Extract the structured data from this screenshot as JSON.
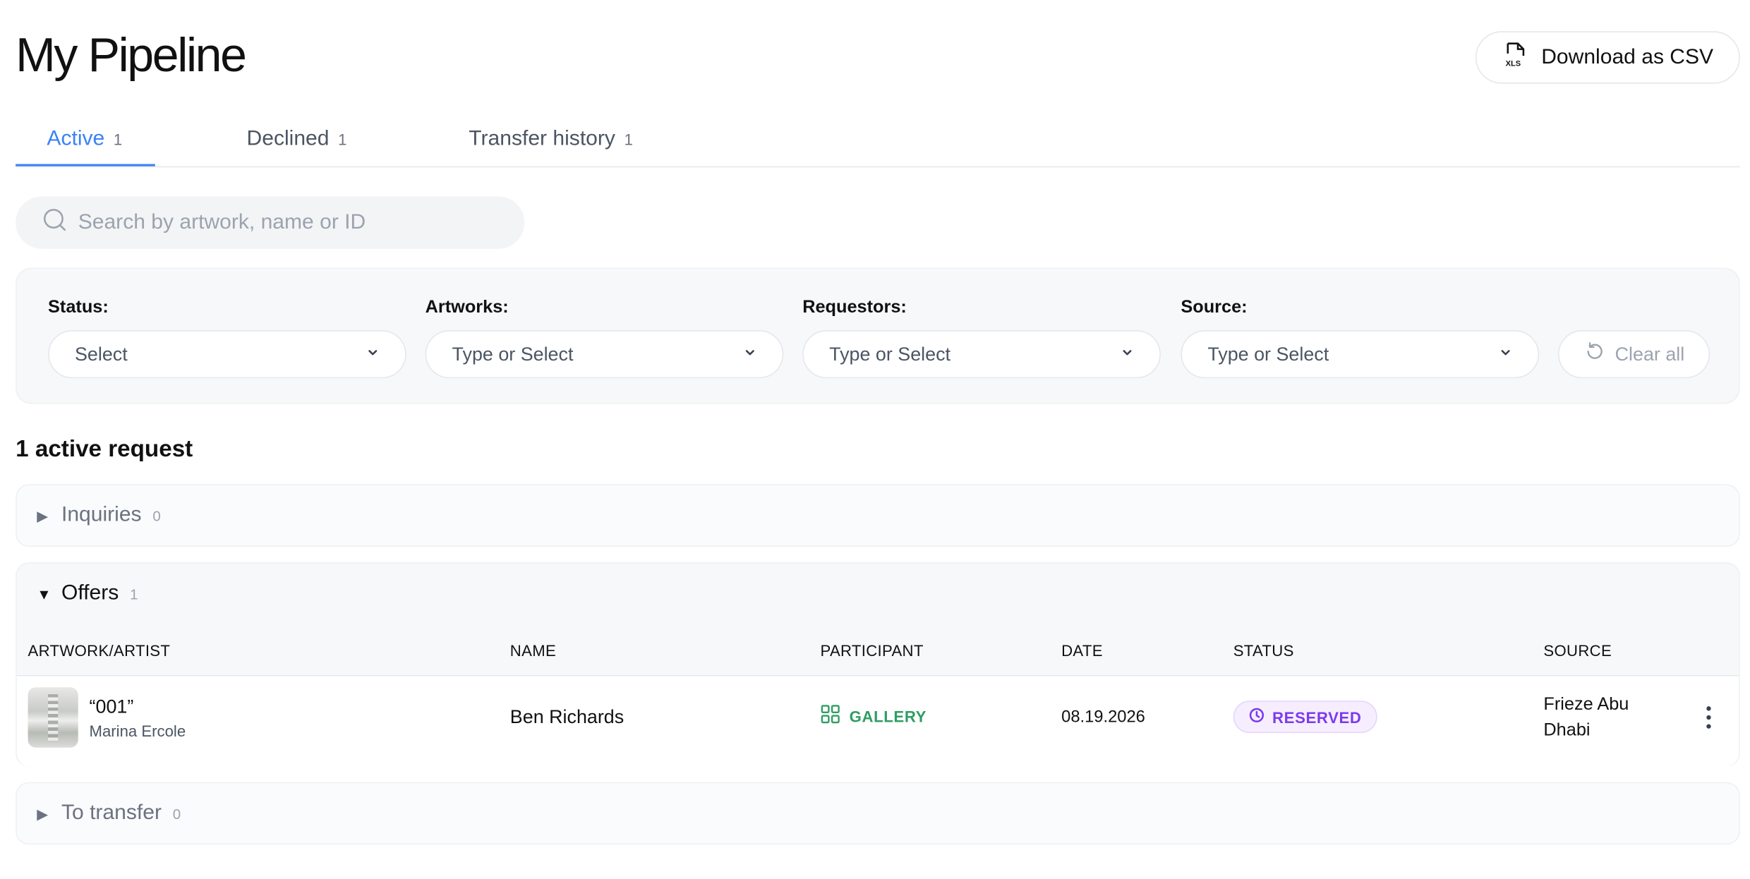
{
  "page": {
    "title": "My Pipeline"
  },
  "header": {
    "download_label": "Download as CSV",
    "download_icon": "xls-file-icon"
  },
  "tabs": [
    {
      "label": "Active",
      "count": "1",
      "active": true
    },
    {
      "label": "Declined",
      "count": "1",
      "active": false
    },
    {
      "label": "Transfer history",
      "count": "1",
      "active": false
    }
  ],
  "search": {
    "placeholder": "Search by artwork, name or ID",
    "value": ""
  },
  "filters": {
    "status": {
      "label": "Status:",
      "value": "Select"
    },
    "artworks": {
      "label": "Artworks:",
      "value": "Type or Select"
    },
    "requestors": {
      "label": "Requestors:",
      "value": "Type or Select"
    },
    "source": {
      "label": "Source:",
      "value": "Type or Select"
    },
    "clear_label": "Clear all"
  },
  "summary": {
    "count_text": "1 active request"
  },
  "sections": {
    "inquiries": {
      "title": "Inquiries",
      "count": "0",
      "expanded": false
    },
    "offers": {
      "title": "Offers",
      "count": "1",
      "expanded": true
    },
    "to_transfer": {
      "title": "To transfer",
      "count": "0",
      "expanded": false
    }
  },
  "table": {
    "columns": [
      "ARTWORK/ARTIST",
      "NAME",
      "PARTICIPANT",
      "DATE",
      "STATUS",
      "SOURCE"
    ],
    "rows": [
      {
        "artwork_title": "“001”",
        "artist": "Marina Ercole",
        "name": "Ben Richards",
        "participant": "GALLERY",
        "date": "08.19.2026",
        "status": "RESERVED",
        "source": "Frieze Abu Dhabi"
      }
    ]
  },
  "colors": {
    "accent": "#3b82f6",
    "gallery": "#2f9d63",
    "reserved": "#7c3aed"
  }
}
